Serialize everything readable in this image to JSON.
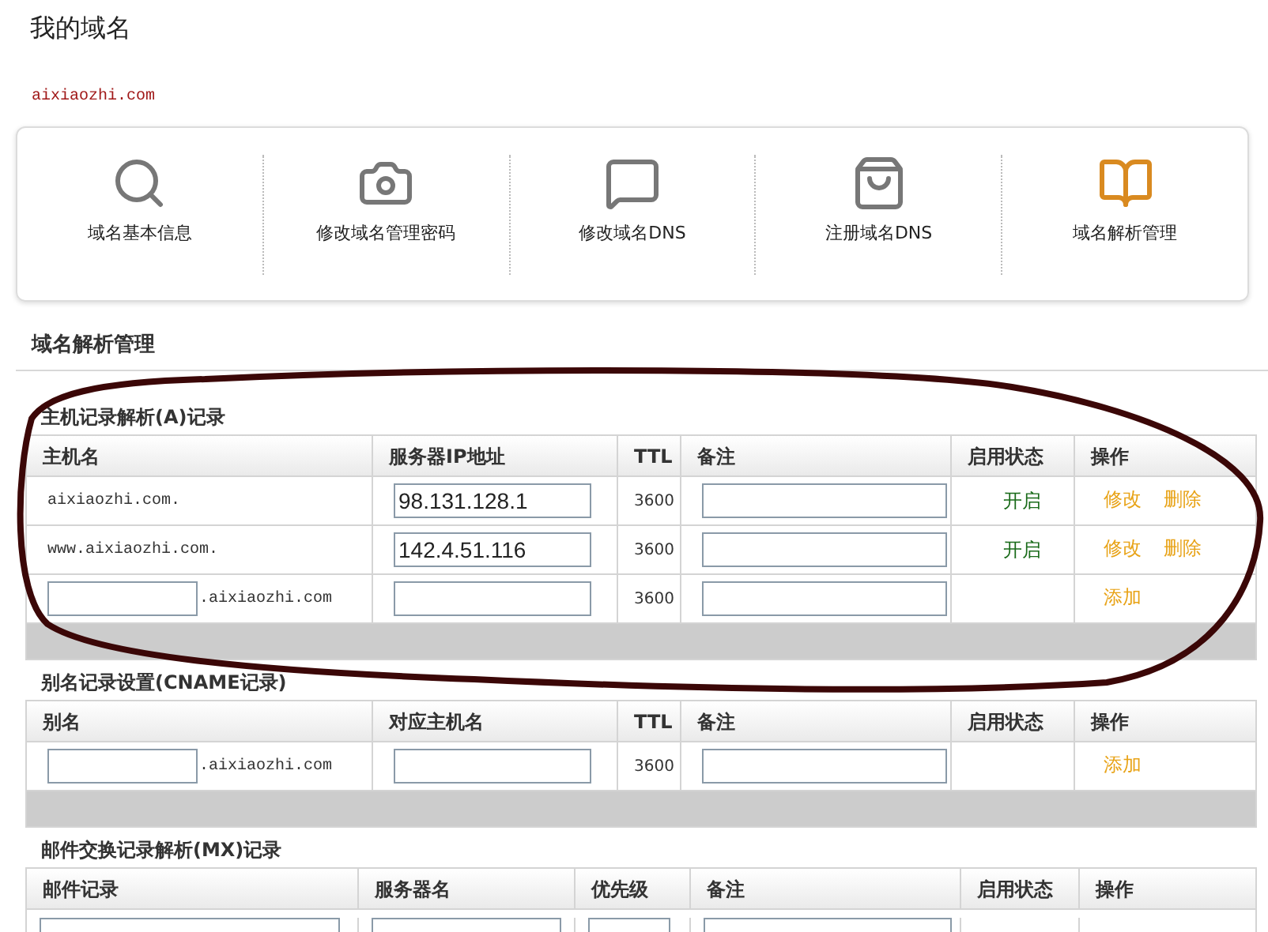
{
  "page_title": "我的域名",
  "domain": "aixiaozhi.com",
  "toolbar": [
    {
      "label": "域名基本信息"
    },
    {
      "label": "修改域名管理密码"
    },
    {
      "label": "修改域名DNS"
    },
    {
      "label": "注册域名DNS"
    },
    {
      "label": "域名解析管理"
    }
  ],
  "section_title": "域名解析管理",
  "tables": [
    {
      "title": "主机记录解析(A)记录",
      "columns": [
        "主机名",
        "服务器IP地址",
        "TTL",
        "备注",
        "启用状态",
        "操作"
      ],
      "rows": [
        {
          "kind": "record",
          "host": "aixiaozhi.com.",
          "value": "98.131.128.1",
          "ttl": "3600",
          "status": "开启",
          "actions": [
            "修改",
            "删除"
          ]
        },
        {
          "kind": "record",
          "host": "www.aixiaozhi.com.",
          "value": "142.4.51.116",
          "ttl": "3600",
          "status": "开启",
          "actions": [
            "修改",
            "删除"
          ]
        },
        {
          "kind": "new",
          "suffix": ".aixiaozhi.com",
          "ttl": "3600",
          "actions": [
            "添加"
          ]
        }
      ]
    },
    {
      "title": "别名记录设置(CNAME记录)",
      "columns": [
        "别名",
        "对应主机名",
        "TTL",
        "备注",
        "启用状态",
        "操作"
      ],
      "rows": [
        {
          "kind": "new",
          "suffix": ".aixiaozhi.com",
          "ttl": "3600",
          "actions": [
            "添加"
          ]
        }
      ]
    },
    {
      "title": "邮件交换记录解析(MX)记录",
      "columns": [
        "邮件记录",
        "服务器名",
        "优先级",
        "备注",
        "启用状态",
        "操作"
      ],
      "rows": [
        {
          "kind": "cut"
        }
      ]
    }
  ]
}
